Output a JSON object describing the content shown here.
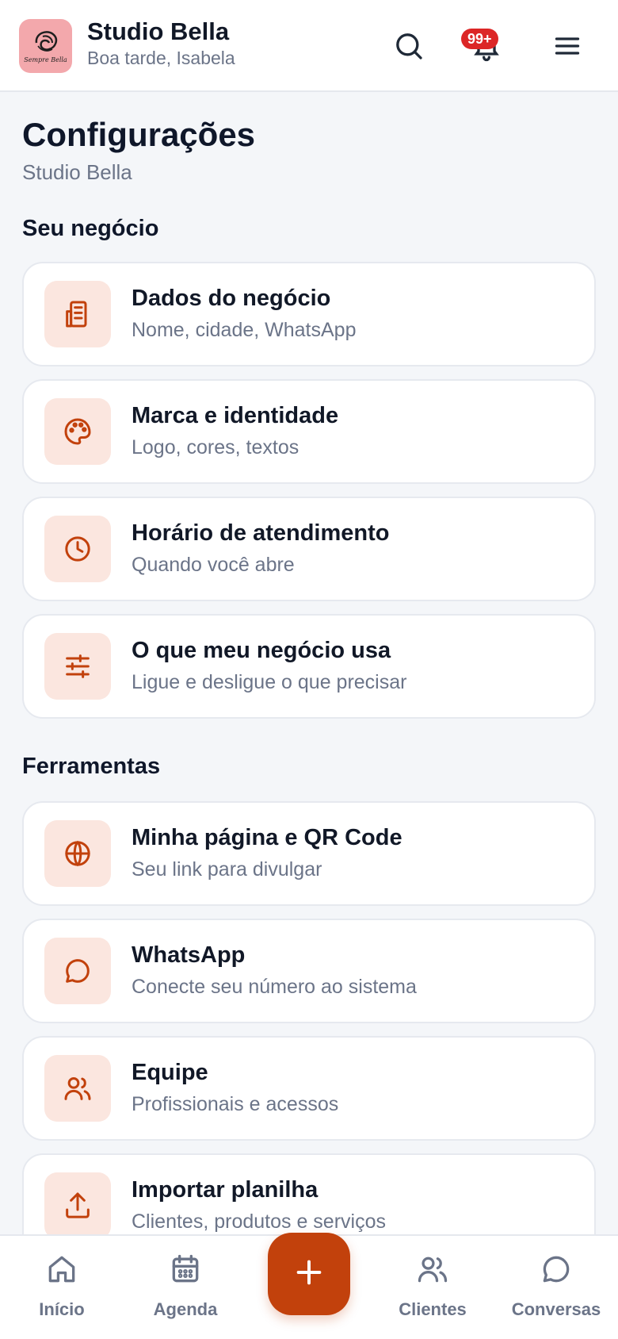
{
  "header": {
    "brand_name": "Studio Bella",
    "greeting": "Boa tarde, Isabela",
    "logo_text": "Sempre Bella",
    "notification_badge": "99+",
    "accent_color": "#c2410c",
    "badge_color": "#dc2626"
  },
  "page": {
    "title": "Configurações",
    "subtitle": "Studio Bella"
  },
  "sections": [
    {
      "title": "Seu negócio",
      "items": [
        {
          "title": "Dados do negócio",
          "subtitle": "Nome, cidade, WhatsApp",
          "icon": "building-icon"
        },
        {
          "title": "Marca e identidade",
          "subtitle": "Logo, cores, textos",
          "icon": "palette-icon"
        },
        {
          "title": "Horário de atendimento",
          "subtitle": "Quando você abre",
          "icon": "clock-icon"
        },
        {
          "title": "O que meu negócio usa",
          "subtitle": "Ligue e desligue o que precisar",
          "icon": "sliders-icon"
        }
      ]
    },
    {
      "title": "Ferramentas",
      "items": [
        {
          "title": "Minha página e QR Code",
          "subtitle": "Seu link para divulgar",
          "icon": "globe-icon"
        },
        {
          "title": "WhatsApp",
          "subtitle": "Conecte seu número ao sistema",
          "icon": "chat-icon"
        },
        {
          "title": "Equipe",
          "subtitle": "Profissionais e acessos",
          "icon": "users-icon"
        },
        {
          "title": "Importar planilha",
          "subtitle": "Clientes, produtos e serviços",
          "icon": "upload-icon"
        }
      ]
    }
  ],
  "bottom_nav": {
    "items": [
      {
        "label": "Início",
        "icon": "home-icon"
      },
      {
        "label": "Agenda",
        "icon": "calendar-icon"
      },
      {
        "label": "Clientes",
        "icon": "users-icon"
      },
      {
        "label": "Conversas",
        "icon": "chat-icon"
      }
    ],
    "fab_icon": "plus-icon"
  }
}
